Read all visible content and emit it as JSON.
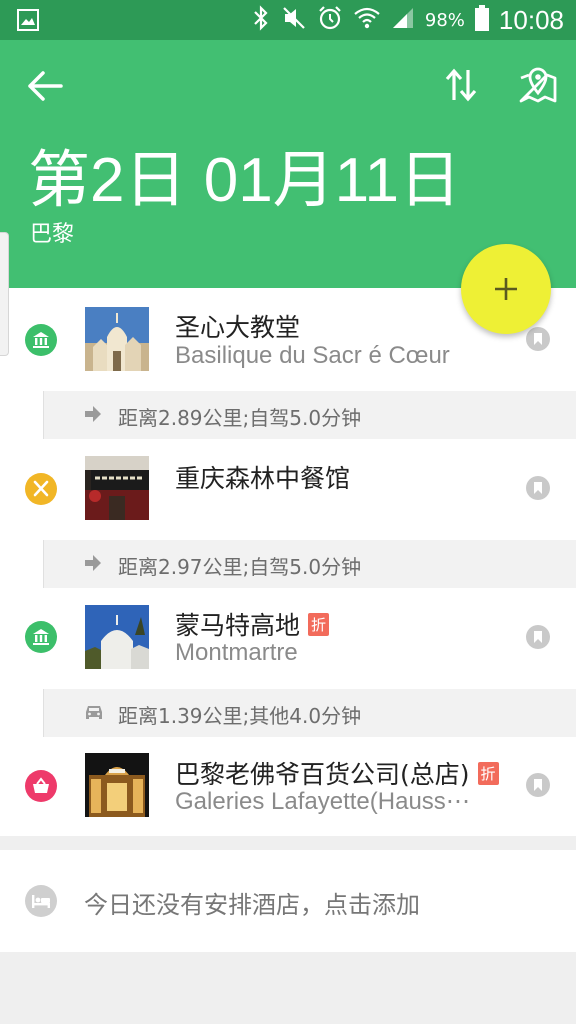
{
  "status_bar": {
    "battery": "98%",
    "time": "10:08",
    "icons": [
      "gallery-icon",
      "bluetooth-icon",
      "mute-icon",
      "alarm-icon",
      "wifi-icon",
      "signal-icon",
      "battery-icon"
    ]
  },
  "header": {
    "title": "第2日 01月11日",
    "subtitle": "巴黎",
    "icons": [
      "back-arrow-icon",
      "sort-icon",
      "map-pin-icon"
    ],
    "color": "#42bf72"
  },
  "fab": {
    "label": "+",
    "color": "#eef035"
  },
  "items": [
    {
      "name": "圣心大教堂",
      "subtitle": "Basilique du Sacr é  Cœur",
      "category": "landmark-icon",
      "category_color": "#3cbf6a",
      "tag": ""
    },
    {
      "name": "重庆森林中餐馆",
      "subtitle": "",
      "category": "restaurant-icon",
      "category_color": "#f1b626",
      "tag": ""
    },
    {
      "name": "蒙马特高地",
      "subtitle": "Montmartre",
      "category": "landmark-icon",
      "category_color": "#3cbf6a",
      "tag": "折"
    },
    {
      "name": "巴黎老佛爷百货公司(总店)",
      "subtitle": "Galeries Lafayette(Hauss⋯",
      "category": "shopping-icon",
      "category_color": "#ee3a6a",
      "tag": "折"
    }
  ],
  "routes": [
    {
      "text": "距离2.89公里;自驾5.0分钟",
      "mode": "arrow-icon"
    },
    {
      "text": "距离2.97公里;自驾5.0分钟",
      "mode": "arrow-icon"
    },
    {
      "text": "距离1.39公里;其他4.0分钟",
      "mode": "car-icon"
    }
  ],
  "hotel": {
    "text": "今日还没有安排酒店，点击添加",
    "icon": "bed-icon"
  }
}
